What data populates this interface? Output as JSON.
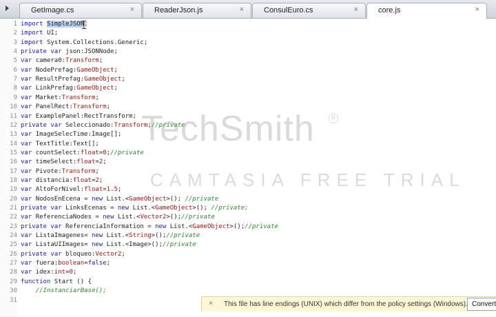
{
  "tabs": [
    {
      "label": "GetImage.cs",
      "close": "×"
    },
    {
      "label": "ReaderJson.js",
      "close": "×"
    },
    {
      "label": "ConsulEuro.cs",
      "close": "×"
    },
    {
      "label": "core.js",
      "close": "×",
      "active": true
    }
  ],
  "code_lines": [
    {
      "n": "1",
      "parts": [
        [
          "kw",
          "import "
        ],
        [
          "hl",
          "SimpleJSON"
        ],
        [
          "",
          "; "
        ]
      ]
    },
    {
      "n": "2",
      "parts": [
        [
          "kw",
          "import "
        ],
        [
          "",
          "UI;"
        ]
      ]
    },
    {
      "n": "3",
      "parts": [
        [
          "kw",
          "import "
        ],
        [
          "",
          "System.Collections.Generic;"
        ]
      ]
    },
    {
      "n": "4",
      "parts": [
        [
          "kw",
          "private var "
        ],
        [
          "",
          "json:JSONNode;"
        ]
      ]
    },
    {
      "n": "5",
      "parts": [
        [
          "kw",
          "var "
        ],
        [
          "",
          "camera0:"
        ],
        [
          "ty",
          "Transform"
        ],
        [
          "",
          ";"
        ]
      ]
    },
    {
      "n": "6",
      "parts": [
        [
          "kw",
          "var "
        ],
        [
          "",
          "NodePrefag:"
        ],
        [
          "ty",
          "GameObject"
        ],
        [
          "",
          ";"
        ]
      ]
    },
    {
      "n": "7",
      "parts": [
        [
          "kw",
          "var "
        ],
        [
          "",
          "ResultPrefag:"
        ],
        [
          "ty",
          "GameObject"
        ],
        [
          "",
          ";"
        ]
      ]
    },
    {
      "n": "8",
      "parts": [
        [
          "kw",
          "var "
        ],
        [
          "",
          "LinkPrefag:"
        ],
        [
          "ty",
          "GameObject"
        ],
        [
          "",
          ";"
        ]
      ]
    },
    {
      "n": "9",
      "parts": [
        [
          "kw",
          "var "
        ],
        [
          "",
          "Market:"
        ],
        [
          "ty",
          "Transform"
        ],
        [
          "",
          ";"
        ]
      ]
    },
    {
      "n": "10",
      "parts": [
        [
          "kw",
          "var "
        ],
        [
          "",
          "PanelRect:"
        ],
        [
          "ty",
          "Transform"
        ],
        [
          "",
          ";"
        ]
      ]
    },
    {
      "n": "11",
      "parts": [
        [
          "kw",
          "var "
        ],
        [
          "",
          "ExamplePanel:RectTransform;"
        ]
      ]
    },
    {
      "n": "12",
      "parts": [
        [
          "kw",
          "private var "
        ],
        [
          "",
          "Seleccionado:"
        ],
        [
          "ty",
          "Transform"
        ],
        [
          "",
          ";"
        ],
        [
          "cm",
          "//private"
        ]
      ]
    },
    {
      "n": "13",
      "parts": [
        [
          "kw",
          "var "
        ],
        [
          "",
          "ImageSelecTime:Image[];"
        ]
      ]
    },
    {
      "n": "14",
      "parts": [
        [
          "kw",
          "var "
        ],
        [
          "",
          "TextTitle:Text[];"
        ]
      ]
    },
    {
      "n": "15",
      "parts": [
        [
          "kw",
          "var "
        ],
        [
          "",
          "countSelect:"
        ],
        [
          "ty",
          "float"
        ],
        [
          "",
          "="
        ],
        [
          "num",
          "0"
        ],
        [
          "",
          ";"
        ],
        [
          "cm",
          "//private"
        ]
      ]
    },
    {
      "n": "16",
      "parts": [
        [
          "kw",
          "var "
        ],
        [
          "",
          "timeSelect:"
        ],
        [
          "ty",
          "float"
        ],
        [
          "",
          "="
        ],
        [
          "num",
          "2"
        ],
        [
          "",
          ";"
        ]
      ]
    },
    {
      "n": "17",
      "parts": [
        [
          "kw",
          "var "
        ],
        [
          "",
          "Pivote:"
        ],
        [
          "ty",
          "Transform"
        ],
        [
          "",
          ";"
        ]
      ]
    },
    {
      "n": "18",
      "parts": [
        [
          "kw",
          "var "
        ],
        [
          "",
          "distancia:"
        ],
        [
          "ty",
          "float"
        ],
        [
          "",
          "="
        ],
        [
          "num",
          "2"
        ],
        [
          "",
          ";"
        ]
      ]
    },
    {
      "n": "19",
      "parts": [
        [
          "kw",
          "var "
        ],
        [
          "",
          "AltoForNivel:"
        ],
        [
          "ty",
          "float"
        ],
        [
          "",
          "="
        ],
        [
          "num",
          "1.5"
        ],
        [
          "",
          ";"
        ]
      ]
    },
    {
      "n": "20",
      "parts": [
        [
          "kw",
          "var "
        ],
        [
          "",
          "NodosEnEcena = "
        ],
        [
          "kw",
          "new "
        ],
        [
          "",
          "List.<"
        ],
        [
          "ty",
          "GameObject"
        ],
        [
          "",
          ">(); "
        ],
        [
          "cm",
          "//private"
        ]
      ]
    },
    {
      "n": "21",
      "parts": [
        [
          "kw",
          "private var "
        ],
        [
          "",
          "LinksEcenas = "
        ],
        [
          "kw",
          "new "
        ],
        [
          "",
          "List.<"
        ],
        [
          "ty",
          "GameObject"
        ],
        [
          "",
          ">(); "
        ],
        [
          "cm",
          "//private;"
        ]
      ]
    },
    {
      "n": "22",
      "parts": [
        [
          "kw",
          "var "
        ],
        [
          "",
          "ReferenciaNodes = "
        ],
        [
          "kw",
          "new "
        ],
        [
          "",
          "List.<"
        ],
        [
          "ty",
          "Vector2"
        ],
        [
          "",
          ">();"
        ],
        [
          "cm",
          "//private"
        ]
      ]
    },
    {
      "n": "23",
      "parts": [
        [
          "kw",
          "private var "
        ],
        [
          "",
          "ReferenciaInformation = "
        ],
        [
          "kw",
          "new "
        ],
        [
          "",
          "List.<"
        ],
        [
          "ty",
          "GameObject"
        ],
        [
          "",
          ">();"
        ],
        [
          "cm",
          "//private"
        ]
      ]
    },
    {
      "n": "24",
      "parts": [
        [
          "kw",
          "var "
        ],
        [
          "",
          "ListaImagenes= "
        ],
        [
          "kw",
          "new "
        ],
        [
          "",
          "List.<"
        ],
        [
          "ty",
          "String"
        ],
        [
          "",
          ">();"
        ],
        [
          "cm",
          "//private"
        ]
      ]
    },
    {
      "n": "25",
      "parts": [
        [
          "kw",
          "var "
        ],
        [
          "",
          "ListaUIImages= "
        ],
        [
          "kw",
          "new "
        ],
        [
          "",
          "List.<Image>();"
        ],
        [
          "cm",
          "//private"
        ]
      ]
    },
    {
      "n": "26",
      "parts": [
        [
          "kw",
          "private var "
        ],
        [
          "",
          "bloqueo:"
        ],
        [
          "ty",
          "Vector2"
        ],
        [
          "",
          ";"
        ]
      ]
    },
    {
      "n": "27",
      "parts": [
        [
          "kw",
          "var "
        ],
        [
          "",
          "fuera:"
        ],
        [
          "ty",
          "boolean"
        ],
        [
          "",
          "="
        ],
        [
          "kw",
          "false"
        ],
        [
          "",
          ";"
        ]
      ]
    },
    {
      "n": "28",
      "parts": [
        [
          "kw",
          "var "
        ],
        [
          "",
          "idex:"
        ],
        [
          "ty",
          "int"
        ],
        [
          "",
          "="
        ],
        [
          "num",
          "0"
        ],
        [
          "",
          ";"
        ]
      ]
    },
    {
      "n": "29",
      "parts": [
        [
          "kw",
          "function "
        ],
        [
          "",
          "Start () {"
        ]
      ]
    },
    {
      "n": "30",
      "parts": [
        [
          "",
          "    "
        ],
        [
          "cm",
          "//InstanciarBase();"
        ]
      ]
    },
    {
      "n": "31",
      "parts": []
    }
  ],
  "watermark": {
    "brand": "TechSmith",
    "reg": "R",
    "trial": "CAMTASIA FREE TRIAL"
  },
  "notice": {
    "close": "×",
    "text": "This file has line endings (UNIX) which differ from the policy settings (Windows).",
    "button": "Convert"
  },
  "colors": {
    "keyword": "#1a1ab0",
    "type": "#a31515",
    "comment": "#2a8a2a",
    "selection": "#b8d1f0",
    "notice_bg": "#fcf8d6"
  },
  "icons": {
    "nav": "tab-scroll-arrow-icon",
    "cursor": "ibeam-cursor-icon",
    "tab_close": "close-icon"
  }
}
